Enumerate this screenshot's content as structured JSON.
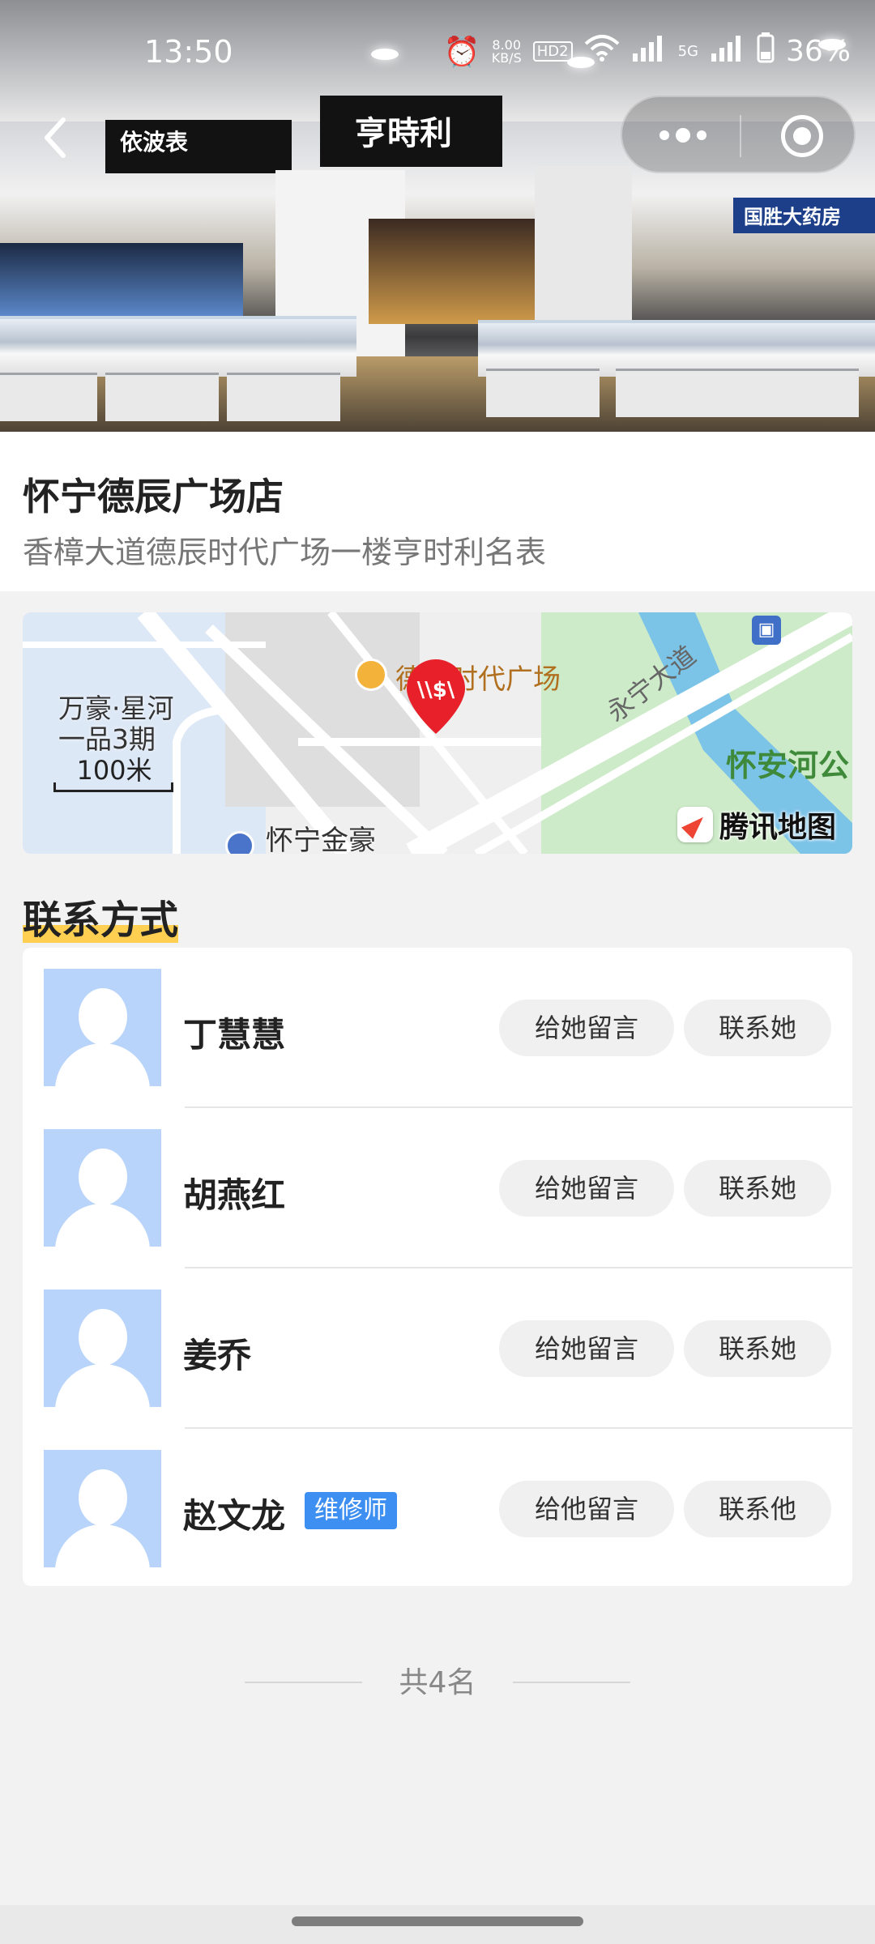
{
  "status_bar": {
    "time": "13:50",
    "net_speed": "8.00",
    "net_unit": "KB/S",
    "hd": "HD2",
    "signal_5g": "5G",
    "battery": "36%"
  },
  "hero": {
    "sign_left": "依波表",
    "sign_center": "亨時利",
    "sign_right": "国胜大药房"
  },
  "store": {
    "name": "怀宁德辰广场店",
    "address": "香樟大道德辰时代广场一楼亨时利名表"
  },
  "map": {
    "poi": "德辰时代广场",
    "area_label": "万豪·星河\n一品3期",
    "scale": "100米",
    "road": "永宁大道",
    "park": "怀安河公",
    "bottom_label": "怀宁金豪",
    "provider": "腾讯地图"
  },
  "contacts": {
    "title": "联系方式",
    "people": [
      {
        "name": "丁慧慧",
        "badge": "",
        "msg_label": "给她留言",
        "call_label": "联系她"
      },
      {
        "name": "胡燕红",
        "badge": "",
        "msg_label": "给她留言",
        "call_label": "联系她"
      },
      {
        "name": "姜乔",
        "badge": "",
        "msg_label": "给她留言",
        "call_label": "联系她"
      },
      {
        "name": "赵文龙",
        "badge": "维修师",
        "msg_label": "给他留言",
        "call_label": "联系他"
      }
    ],
    "total": "共4名"
  },
  "colors": {
    "badge": "#3d8ff2",
    "title_highlight": "#ffcf52",
    "avatar_bg": "#b8d4fa",
    "pin": "#e8202a"
  }
}
